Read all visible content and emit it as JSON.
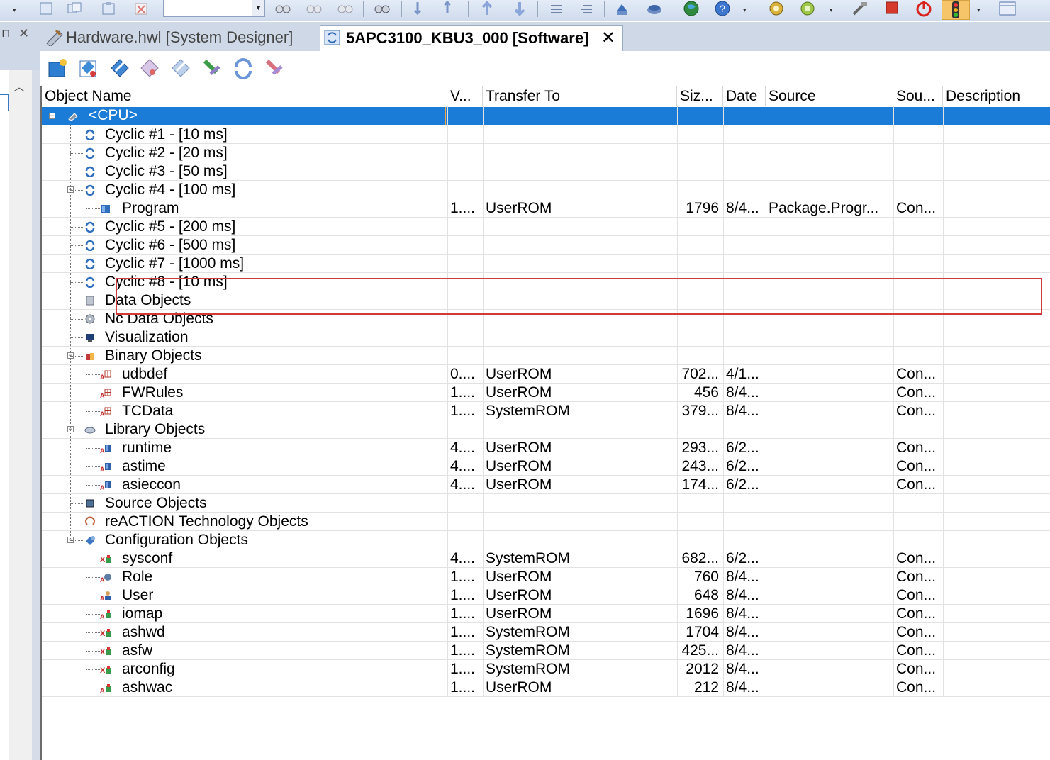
{
  "toolbar": {
    "combo_value": "",
    "icons": [
      "new-icon",
      "copy-icon",
      "paste-icon",
      "delete-icon",
      "find-icon",
      "find-next-icon",
      "find-prev-icon",
      "binoculars-icon",
      "sort-asc-icon",
      "sort-desc-icon",
      "move-up-icon",
      "move-down-icon",
      "align-icon",
      "align-indent-icon",
      "upload-icon",
      "cloud-icon",
      "globe-icon",
      "help-icon",
      "gear-icon",
      "debug-icon",
      "tools-icon",
      "stop-icon",
      "power-icon",
      "traffic-light-icon",
      "calendar-icon"
    ]
  },
  "tabs": [
    {
      "label": "Hardware.hwl [System Designer]",
      "active": false
    },
    {
      "label": "5APC3100_KBU3_000 [Software]",
      "active": true
    }
  ],
  "subtoolbar": {
    "icons": [
      "add-object-icon",
      "properties-icon",
      "edit-icon",
      "cut-icon",
      "note-icon",
      "insert-icon",
      "refresh-icon",
      "remove-icon"
    ]
  },
  "columns": [
    "Object Name",
    "V...",
    "Transfer To",
    "Siz...",
    "Date",
    "Source",
    "Sou...",
    "Description"
  ],
  "rows": [
    {
      "name": "<CPU>",
      "icon": "cpu-icon",
      "version": "",
      "transfer": "",
      "size": "",
      "date": "",
      "source": "",
      "sou": "",
      "desc": ""
    },
    {
      "name": "Cyclic #1 - [10 ms]",
      "icon": "cyclic-icon",
      "version": "",
      "transfer": "",
      "size": "",
      "date": "",
      "source": "",
      "sou": "",
      "desc": ""
    },
    {
      "name": "Cyclic #2 - [20 ms]",
      "icon": "cyclic-icon",
      "version": "",
      "transfer": "",
      "size": "",
      "date": "",
      "source": "",
      "sou": "",
      "desc": ""
    },
    {
      "name": "Cyclic #3 - [50 ms]",
      "icon": "cyclic-icon",
      "version": "",
      "transfer": "",
      "size": "",
      "date": "",
      "source": "",
      "sou": "",
      "desc": ""
    },
    {
      "name": "Cyclic #4 - [100 ms]",
      "icon": "cyclic-icon",
      "version": "",
      "transfer": "",
      "size": "",
      "date": "",
      "source": "",
      "sou": "",
      "desc": ""
    },
    {
      "name": "Program",
      "icon": "program-icon",
      "version": "1....",
      "transfer": "UserROM",
      "size": "1796",
      "date": "8/4...",
      "source": "Package.Progr...",
      "sou": "Con...",
      "desc": ""
    },
    {
      "name": "Cyclic #5 - [200 ms]",
      "icon": "cyclic-icon",
      "version": "",
      "transfer": "",
      "size": "",
      "date": "",
      "source": "",
      "sou": "",
      "desc": ""
    },
    {
      "name": "Cyclic #6 - [500 ms]",
      "icon": "cyclic-icon",
      "version": "",
      "transfer": "",
      "size": "",
      "date": "",
      "source": "",
      "sou": "",
      "desc": ""
    },
    {
      "name": "Cyclic #7 - [1000 ms]",
      "icon": "cyclic-icon",
      "version": "",
      "transfer": "",
      "size": "",
      "date": "",
      "source": "",
      "sou": "",
      "desc": ""
    },
    {
      "name": "Cyclic #8 - [10 ms]",
      "icon": "cyclic-icon",
      "version": "",
      "transfer": "",
      "size": "",
      "date": "",
      "source": "",
      "sou": "",
      "desc": ""
    },
    {
      "name": "Data Objects",
      "icon": "data-objects-icon",
      "version": "",
      "transfer": "",
      "size": "",
      "date": "",
      "source": "",
      "sou": "",
      "desc": ""
    },
    {
      "name": "Nc Data Objects",
      "icon": "nc-data-icon",
      "version": "",
      "transfer": "",
      "size": "",
      "date": "",
      "source": "",
      "sou": "",
      "desc": ""
    },
    {
      "name": "Visualization",
      "icon": "visualization-icon",
      "version": "",
      "transfer": "",
      "size": "",
      "date": "",
      "source": "",
      "sou": "",
      "desc": ""
    },
    {
      "name": "Binary Objects",
      "icon": "binary-objects-icon",
      "version": "",
      "transfer": "",
      "size": "",
      "date": "",
      "source": "",
      "sou": "",
      "desc": ""
    },
    {
      "name": "udbdef",
      "icon": "binary-file-icon",
      "version": "0....",
      "transfer": "UserROM",
      "size": "702...",
      "date": "4/1...",
      "source": "",
      "sou": "Con...",
      "desc": ""
    },
    {
      "name": "FWRules",
      "icon": "binary-file-icon",
      "version": "1....",
      "transfer": "UserROM",
      "size": "456",
      "date": "8/4...",
      "source": "",
      "sou": "Con...",
      "desc": ""
    },
    {
      "name": "TCData",
      "icon": "binary-file-icon",
      "version": "1....",
      "transfer": "SystemROM",
      "size": "379...",
      "date": "8/4...",
      "source": "",
      "sou": "Con...",
      "desc": ""
    },
    {
      "name": "Library Objects",
      "icon": "library-objects-icon",
      "version": "",
      "transfer": "",
      "size": "",
      "date": "",
      "source": "",
      "sou": "",
      "desc": ""
    },
    {
      "name": "runtime",
      "icon": "library-file-icon",
      "version": "4....",
      "transfer": "UserROM",
      "size": "293...",
      "date": "6/2...",
      "source": "",
      "sou": "Con...",
      "desc": ""
    },
    {
      "name": "astime",
      "icon": "library-file-icon",
      "version": "4....",
      "transfer": "UserROM",
      "size": "243...",
      "date": "6/2...",
      "source": "",
      "sou": "Con...",
      "desc": ""
    },
    {
      "name": "asieccon",
      "icon": "library-file-icon",
      "version": "4....",
      "transfer": "UserROM",
      "size": "174...",
      "date": "6/2...",
      "source": "",
      "sou": "Con...",
      "desc": ""
    },
    {
      "name": "Source Objects",
      "icon": "source-objects-icon",
      "version": "",
      "transfer": "",
      "size": "",
      "date": "",
      "source": "",
      "sou": "",
      "desc": ""
    },
    {
      "name": "reACTION Technology Objects",
      "icon": "reaction-icon",
      "version": "",
      "transfer": "",
      "size": "",
      "date": "",
      "source": "",
      "sou": "",
      "desc": ""
    },
    {
      "name": "Configuration Objects",
      "icon": "configuration-objects-icon",
      "version": "",
      "transfer": "",
      "size": "",
      "date": "",
      "source": "",
      "sou": "",
      "desc": ""
    },
    {
      "name": "sysconf",
      "icon": "config-file-x-icon",
      "version": "4....",
      "transfer": "SystemROM",
      "size": "682...",
      "date": "6/2...",
      "source": "",
      "sou": "Con...",
      "desc": ""
    },
    {
      "name": "Role",
      "icon": "role-icon",
      "version": "1....",
      "transfer": "UserROM",
      "size": "760",
      "date": "8/4...",
      "source": "",
      "sou": "Con...",
      "desc": ""
    },
    {
      "name": "User",
      "icon": "user-icon",
      "version": "1....",
      "transfer": "UserROM",
      "size": "648",
      "date": "8/4...",
      "source": "",
      "sou": "Con...",
      "desc": ""
    },
    {
      "name": "iomap",
      "icon": "config-file-icon",
      "version": "1....",
      "transfer": "UserROM",
      "size": "1696",
      "date": "8/4...",
      "source": "",
      "sou": "Con...",
      "desc": ""
    },
    {
      "name": "ashwd",
      "icon": "config-file-x-icon",
      "version": "1....",
      "transfer": "SystemROM",
      "size": "1704",
      "date": "8/4...",
      "source": "",
      "sou": "Con...",
      "desc": ""
    },
    {
      "name": "asfw",
      "icon": "config-file-x-icon",
      "version": "1....",
      "transfer": "SystemROM",
      "size": "425...",
      "date": "8/4...",
      "source": "",
      "sou": "Con...",
      "desc": ""
    },
    {
      "name": "arconfig",
      "icon": "config-file-x-icon",
      "version": "1....",
      "transfer": "SystemROM",
      "size": "2012",
      "date": "8/4...",
      "source": "",
      "sou": "Con...",
      "desc": ""
    },
    {
      "name": "ashwac",
      "icon": "config-file-icon",
      "version": "1....",
      "transfer": "UserROM",
      "size": "212",
      "date": "8/4...",
      "source": "",
      "sou": "Con...",
      "desc": ""
    }
  ],
  "colors": {
    "selection": "#1a7cd6",
    "highlight_box": "#d23a3a",
    "panel": "#cfd8e6"
  }
}
